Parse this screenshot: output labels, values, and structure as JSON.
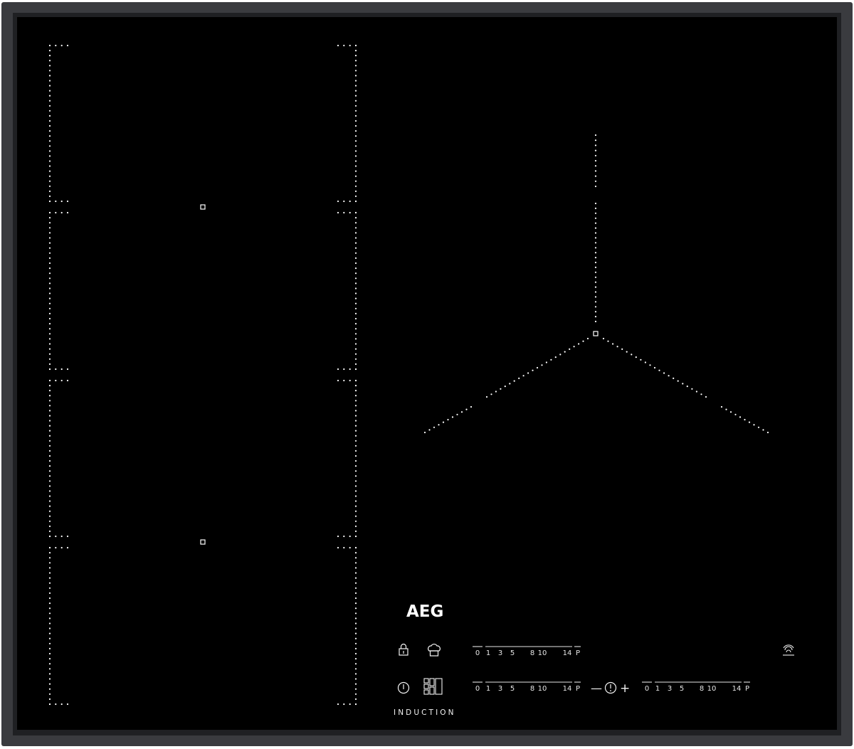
{
  "brand": {
    "logo_text": "AEG",
    "tagline": "INDUCTION"
  },
  "colors": {
    "glass": "#000000",
    "frame": "#3a3b3f",
    "frame_edge": "#222326",
    "print": "#f2f2f2"
  },
  "controls": {
    "lock_icon": "lock-icon",
    "chef_icon": "chef-hat-icon",
    "power_icon": "power-icon",
    "zone_selector_icon": "zone-selector-icon",
    "hood_link_icon": "hob-to-hood-icon",
    "timer": {
      "minus": "—",
      "plus": "+",
      "icon": "timer-icon"
    }
  },
  "sliders": [
    {
      "id": "slider-top-left",
      "scale": [
        "0",
        "1",
        "3",
        "5",
        "8",
        "10",
        "14",
        "P"
      ]
    },
    {
      "id": "slider-bottom-left",
      "scale": [
        "0",
        "1",
        "3",
        "5",
        "8",
        "10",
        "14",
        "P"
      ]
    },
    {
      "id": "slider-bottom-right",
      "scale": [
        "0",
        "1",
        "3",
        "5",
        "8",
        "10",
        "14",
        "P"
      ]
    }
  ]
}
